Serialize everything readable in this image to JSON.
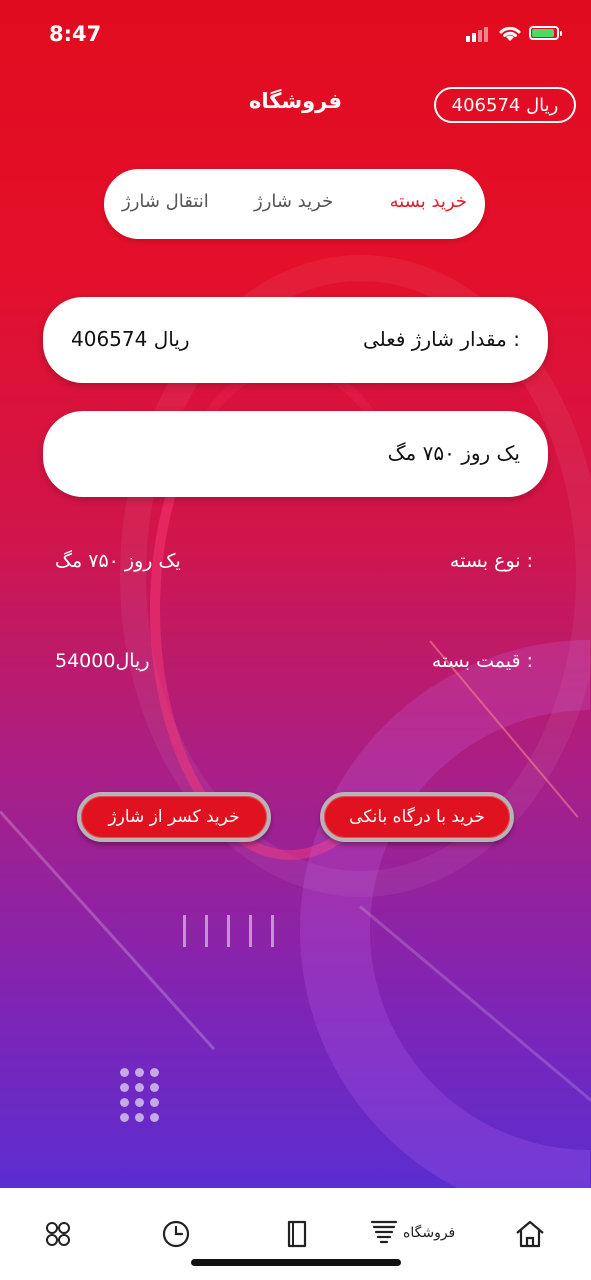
{
  "status_bar": {
    "time": "8:47"
  },
  "header": {
    "title": "فروشگاه",
    "balance": "406574 ریال"
  },
  "tabs": [
    {
      "label": "خرید بسته",
      "active": true
    },
    {
      "label": "خرید شارژ",
      "active": false
    },
    {
      "label": "انتقال شارژ",
      "active": false
    }
  ],
  "current_charge": {
    "label": "مقدار شارژ فعلی :",
    "value": "406574 ریال"
  },
  "package_select": {
    "value": "یک روز ۷۵۰ مگ"
  },
  "package_info": {
    "type_label": "نوع بسته :",
    "type_value": "یک روز ۷۵۰ مگ",
    "price_label": "قیمت بسته :",
    "price_value": "54000ریال"
  },
  "actions": {
    "bank_gateway": "خرید با درگاه بانکی",
    "from_charge": "خرید کسر از شارژ"
  },
  "bottom_nav": [
    {
      "icon": "home-icon"
    },
    {
      "icon": "store-icon",
      "label": "فروشگاه"
    },
    {
      "icon": "book-icon"
    },
    {
      "icon": "clock-icon"
    },
    {
      "icon": "apps-icon"
    }
  ],
  "colors": {
    "accent": "#e0121f",
    "active_tab": "#e0202a"
  }
}
